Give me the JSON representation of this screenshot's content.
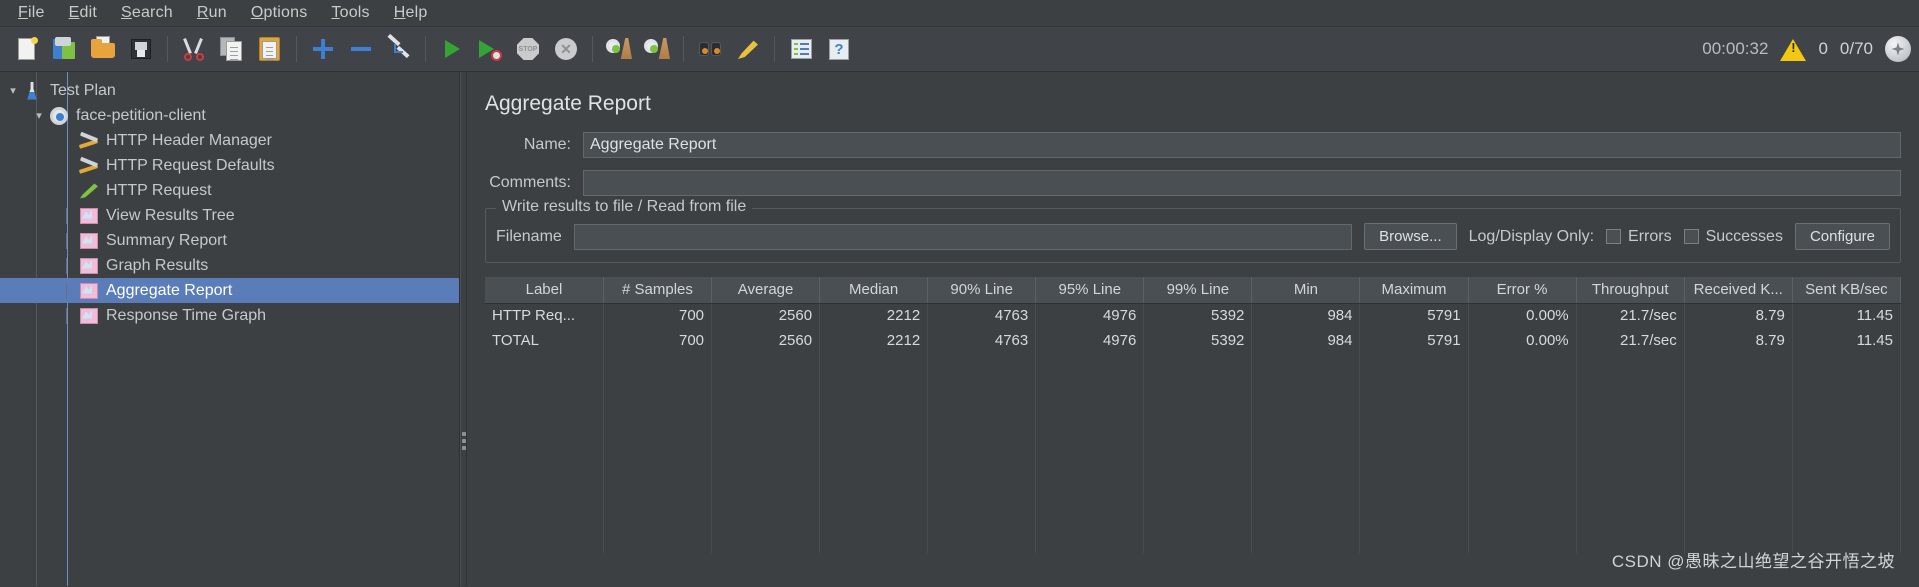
{
  "menubar": {
    "items": [
      {
        "label": "File",
        "mnemonic": "F",
        "rest": "ile"
      },
      {
        "label": "Edit",
        "mnemonic": "E",
        "rest": "dit"
      },
      {
        "label": "Search",
        "mnemonic": "S",
        "rest": "earch"
      },
      {
        "label": "Run",
        "mnemonic": "R",
        "rest": "un"
      },
      {
        "label": "Options",
        "mnemonic": "O",
        "rest": "ptions"
      },
      {
        "label": "Tools",
        "mnemonic": "T",
        "rest": "ools"
      },
      {
        "label": "Help",
        "mnemonic": "H",
        "rest": "elp"
      }
    ]
  },
  "toolbar": {
    "buttons": [
      {
        "name": "new-button",
        "icon": "new-document-icon"
      },
      {
        "name": "templates-button",
        "icon": "templates-icon"
      },
      {
        "name": "open-button",
        "icon": "open-folder-icon"
      },
      {
        "name": "save-button",
        "icon": "save-floppy-icon"
      },
      {
        "name": "cut-button",
        "icon": "scissors-icon"
      },
      {
        "name": "copy-button",
        "icon": "copy-icon"
      },
      {
        "name": "paste-button",
        "icon": "clipboard-paste-icon"
      },
      {
        "name": "expand-button",
        "icon": "plus-icon"
      },
      {
        "name": "collapse-button",
        "icon": "minus-icon"
      },
      {
        "name": "toggle-button",
        "icon": "toggle-pencil-icon"
      },
      {
        "name": "start-button",
        "icon": "play-green-icon"
      },
      {
        "name": "start-no-pauses-button",
        "icon": "play-no-pause-icon"
      },
      {
        "name": "stop-button",
        "icon": "stop-sign-icon"
      },
      {
        "name": "shutdown-button",
        "icon": "shutdown-circle-icon"
      },
      {
        "name": "clear-button",
        "icon": "gear-broom-icon"
      },
      {
        "name": "clear-all-button",
        "icon": "gear-broom-all-icon"
      },
      {
        "name": "search-button",
        "icon": "binoculars-icon"
      },
      {
        "name": "reset-search-button",
        "icon": "highlighter-icon"
      },
      {
        "name": "function-helper-button",
        "icon": "report-list-icon"
      },
      {
        "name": "help-button",
        "icon": "help-question-icon"
      }
    ],
    "timer": "00:00:32",
    "warning_count": "0",
    "thread_count": "0/70",
    "warning_icon": "warning-triangle-icon",
    "status_icon": "connection-orb-icon"
  },
  "tree": {
    "items": [
      {
        "label": "Test Plan",
        "icon": "test-plan-icon",
        "depth": 0,
        "expanded": true,
        "selected": false
      },
      {
        "label": "face-petition-client",
        "icon": "thread-group-gear-icon",
        "depth": 1,
        "expanded": true,
        "selected": false
      },
      {
        "label": "HTTP Header Manager",
        "icon": "config-tools-icon",
        "depth": 2,
        "selected": false
      },
      {
        "label": "HTTP Request Defaults",
        "icon": "config-tools-icon",
        "depth": 2,
        "selected": false
      },
      {
        "label": "HTTP Request",
        "icon": "sampler-pen-icon",
        "depth": 2,
        "selected": false
      },
      {
        "label": "View Results Tree",
        "icon": "listener-chart-icon",
        "depth": 2,
        "selected": false
      },
      {
        "label": "Summary Report",
        "icon": "listener-chart-icon",
        "depth": 2,
        "selected": false
      },
      {
        "label": "Graph Results",
        "icon": "listener-chart-icon",
        "depth": 2,
        "selected": false
      },
      {
        "label": "Aggregate Report",
        "icon": "listener-chart-icon",
        "depth": 2,
        "selected": true
      },
      {
        "label": "Response Time Graph",
        "icon": "listener-chart-icon",
        "depth": 2,
        "selected": false
      }
    ]
  },
  "panel": {
    "title": "Aggregate Report",
    "name_label": "Name:",
    "name_value": "Aggregate Report",
    "comments_label": "Comments:",
    "comments_value": "",
    "group_title": "Write results to file / Read from file",
    "filename_label": "Filename",
    "filename_value": "",
    "browse_label": "Browse...",
    "log_display_label": "Log/Display Only:",
    "errors_label": "Errors",
    "errors_checked": false,
    "successes_label": "Successes",
    "successes_checked": false,
    "configure_label": "Configure"
  },
  "table": {
    "columns": [
      "Label",
      "# Samples",
      "Average",
      "Median",
      "90% Line",
      "95% Line",
      "99% Line",
      "Min",
      "Maximum",
      "Error %",
      "Throughput",
      "Received K...",
      "Sent KB/sec"
    ],
    "rows": [
      [
        "HTTP Req...",
        "700",
        "2560",
        "2212",
        "4763",
        "4976",
        "5392",
        "984",
        "5791",
        "0.00%",
        "21.7/sec",
        "8.79",
        "11.45"
      ],
      [
        "TOTAL",
        "700",
        "2560",
        "2212",
        "4763",
        "4976",
        "5392",
        "984",
        "5791",
        "0.00%",
        "21.7/sec",
        "8.79",
        "11.45"
      ]
    ]
  },
  "watermark": "CSDN @愚昧之山绝望之谷开悟之坡",
  "colors": {
    "background": "#3c4043",
    "toolbar": "#404449",
    "selection": "#5a7cb8",
    "header": "#4a4f54",
    "text": "#c5c9cd",
    "accent_green": "#35a335",
    "accent_blue": "#3f7fd0",
    "warning_yellow": "#f2c811"
  }
}
